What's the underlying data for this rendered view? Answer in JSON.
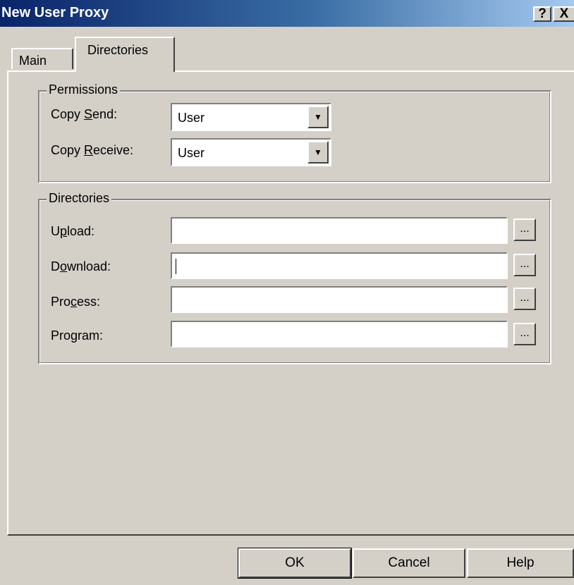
{
  "window": {
    "title": "New User Proxy",
    "help_button": "?",
    "close_button": "X"
  },
  "tabs": [
    {
      "label": "Main",
      "selected": false
    },
    {
      "label": "Directories",
      "selected": true
    }
  ],
  "permissions": {
    "legend": "Permissions",
    "copy_send": {
      "label_pre": "Copy ",
      "label_accel": "S",
      "label_post": "end:",
      "value": "User"
    },
    "copy_receive": {
      "label_pre": "Copy ",
      "label_accel": "R",
      "label_post": "eceive:",
      "value": "User"
    }
  },
  "directories": {
    "legend": "Directories",
    "upload": {
      "label_pre": "U",
      "label_accel": "p",
      "label_post": "load:",
      "value": ""
    },
    "download": {
      "label_pre": "D",
      "label_accel": "o",
      "label_post": "wnload:",
      "value": ""
    },
    "process": {
      "label_pre": "Pro",
      "label_accel": "c",
      "label_post": "ess:",
      "value": ""
    },
    "program": {
      "label_pre": "Pro",
      "label_accel": "g",
      "label_post": "ram:",
      "value": ""
    },
    "browse_label": "..."
  },
  "buttons": {
    "ok": "OK",
    "cancel": "Cancel",
    "help": "Help"
  }
}
